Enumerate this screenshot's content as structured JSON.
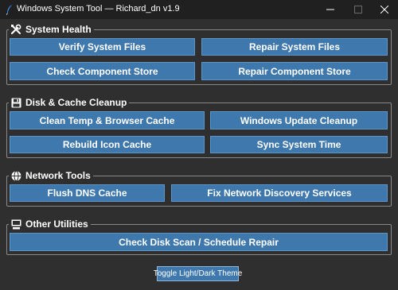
{
  "window": {
    "title": "Windows System Tool — Richard_dn v1.9",
    "icons": {
      "app": "feather-icon",
      "minimize": "minimize-icon",
      "maximize": "maximize-icon",
      "close": "close-icon"
    }
  },
  "groups": {
    "system_health": {
      "title": "System Health",
      "icon": "tools-icon",
      "buttons": {
        "verify": "Verify System Files",
        "repair": "Repair System Files",
        "check_store": "Check Component Store",
        "repair_store": "Repair Component Store"
      }
    },
    "disk_cleanup": {
      "title": "Disk & Cache Cleanup",
      "icon": "floppy-disk-icon",
      "buttons": {
        "clean_temp": "Clean Temp & Browser Cache",
        "win_update": "Windows Update Cleanup",
        "rebuild_icon": "Rebuild Icon Cache",
        "sync_time": "Sync System Time"
      }
    },
    "network_tools": {
      "title": "Network Tools",
      "icon": "globe-icon",
      "buttons": {
        "flush_dns": "Flush DNS Cache",
        "fix_network": "Fix Network Discovery Services"
      }
    },
    "other_utilities": {
      "title": "Other Utilities",
      "icon": "monitor-icon",
      "buttons": {
        "disk_scan": "Check Disk Scan / Schedule Repair"
      }
    }
  },
  "footer": {
    "toggle_theme": "Toggle Light/Dark Theme"
  },
  "colors": {
    "background": "#2f2f2f",
    "titlebar": "#202020",
    "button": "#3f78ad",
    "button_border": "#5d95c8",
    "group_border": "#8a8a8a",
    "text": "#ffffff"
  }
}
